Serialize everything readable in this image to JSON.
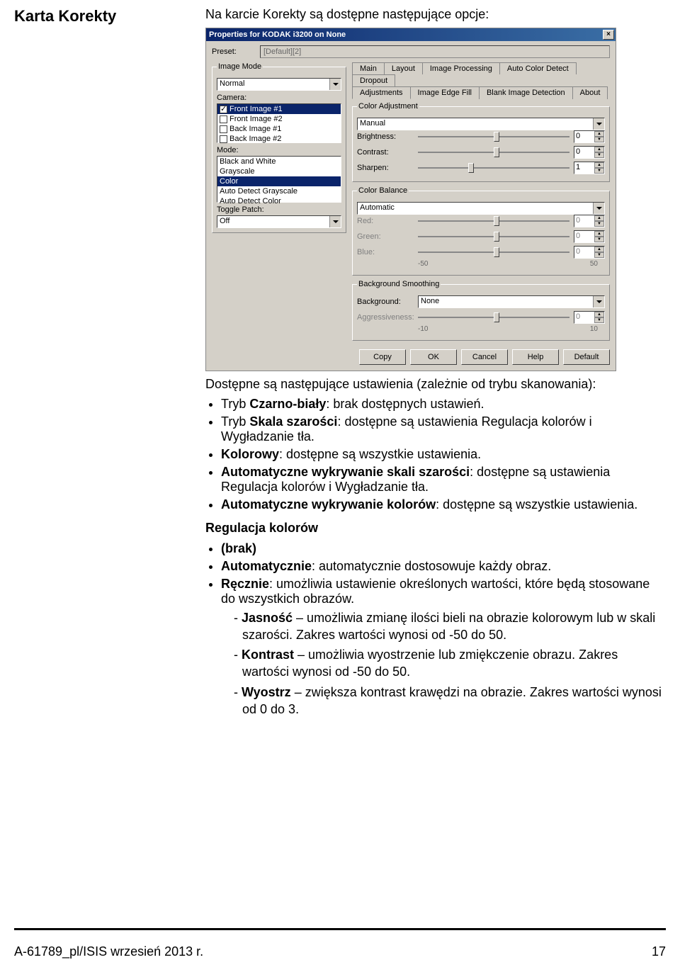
{
  "heading": "Karta Korekty",
  "intro": "Na karcie Korekty są dostępne następujące opcje:",
  "dialog": {
    "title": "Properties for KODAK i3200 on None",
    "close": "×",
    "preset_label": "Preset:",
    "preset_value": "[Default][2]",
    "image_mode": {
      "legend": "Image Mode",
      "mode_value": "Normal",
      "camera_label": "Camera:",
      "camera_items": [
        "Front Image #1",
        "Front Image #2",
        "Back Image #1",
        "Back Image #2"
      ],
      "mode_label": "Mode:",
      "mode_items": [
        "Black and White",
        "Grayscale",
        "Color",
        "Auto Detect Grayscale",
        "Auto Detect Color"
      ],
      "mode_selected_index": 2,
      "toggle_label": "Toggle Patch:",
      "toggle_value": "Off"
    },
    "tabs_row1": [
      "Main",
      "Layout",
      "Image Processing",
      "Auto Color Detect",
      "Dropout"
    ],
    "tabs_row2": [
      "Adjustments",
      "Image Edge Fill",
      "Blank Image Detection",
      "About"
    ],
    "color_adjustment": {
      "legend": "Color Adjustment",
      "mode": "Manual",
      "brightness_label": "Brightness:",
      "brightness_value": "0",
      "contrast_label": "Contrast:",
      "contrast_value": "0",
      "sharpen_label": "Sharpen:",
      "sharpen_value": "1"
    },
    "color_balance": {
      "legend": "Color Balance",
      "mode": "Automatic",
      "red_label": "Red:",
      "red_value": "0",
      "green_label": "Green:",
      "green_value": "0",
      "blue_label": "Blue:",
      "blue_value": "0",
      "scale_min": "-50",
      "scale_max": "50"
    },
    "bg_smoothing": {
      "legend": "Background Smoothing",
      "background_label": "Background:",
      "background_value": "None",
      "aggr_label": "Aggressiveness:",
      "aggr_value": "0",
      "scale_min": "-10",
      "scale_max": "10"
    },
    "buttons": {
      "copy": "Copy",
      "ok": "OK",
      "cancel": "Cancel",
      "help": "Help",
      "default": "Default"
    }
  },
  "body": {
    "p1": "Dostępne są następujące ustawienia (zależnie od trybu skanowania):",
    "li1a": "Tryb ",
    "li1b": "Czarno-biały",
    "li1c": ": brak dostępnych ustawień.",
    "li2a": "Tryb ",
    "li2b": "Skala szarości",
    "li2c": ": dostępne są ustawienia Regulacja kolorów i Wygładzanie tła.",
    "li3a": "Kolorowy",
    "li3b": ": dostępne są wszystkie ustawienia.",
    "li4a": "Automatyczne wykrywanie skali szarości",
    "li4b": ": dostępne są ustawienia Regulacja kolorów i Wygładzanie tła.",
    "li5a": "Automatyczne wykrywanie kolorów",
    "li5b": ": dostępne są wszystkie ustawienia.",
    "h_reg": "Regulacja kolorów",
    "li_brak": "(brak)",
    "li_auto_a": "Automatycznie",
    "li_auto_b": ": automatycznie dostosowuje każdy obraz.",
    "li_man_a": "Ręcznie",
    "li_man_b": ": umożliwia ustawienie określonych wartości, które będą stosowane do wszystkich obrazów.",
    "s1a": "- ",
    "s1b": "Jasność",
    "s1c": " – umożliwia zmianę ilości bieli na obrazie kolorowym lub w skali szarości. Zakres wartości wynosi od -50 do 50.",
    "s2a": "- ",
    "s2b": "Kontrast",
    "s2c": " – umożliwia wyostrzenie lub zmiękczenie obrazu. Zakres wartości wynosi od -50 do 50.",
    "s3a": "- ",
    "s3b": "Wyostrz",
    "s3c": " – zwiększa kontrast krawędzi na obrazie. Zakres wartości wynosi od 0 do 3."
  },
  "footer": {
    "left": "A-61789_pl/ISIS  wrzesień 2013 r.",
    "right": "17"
  }
}
